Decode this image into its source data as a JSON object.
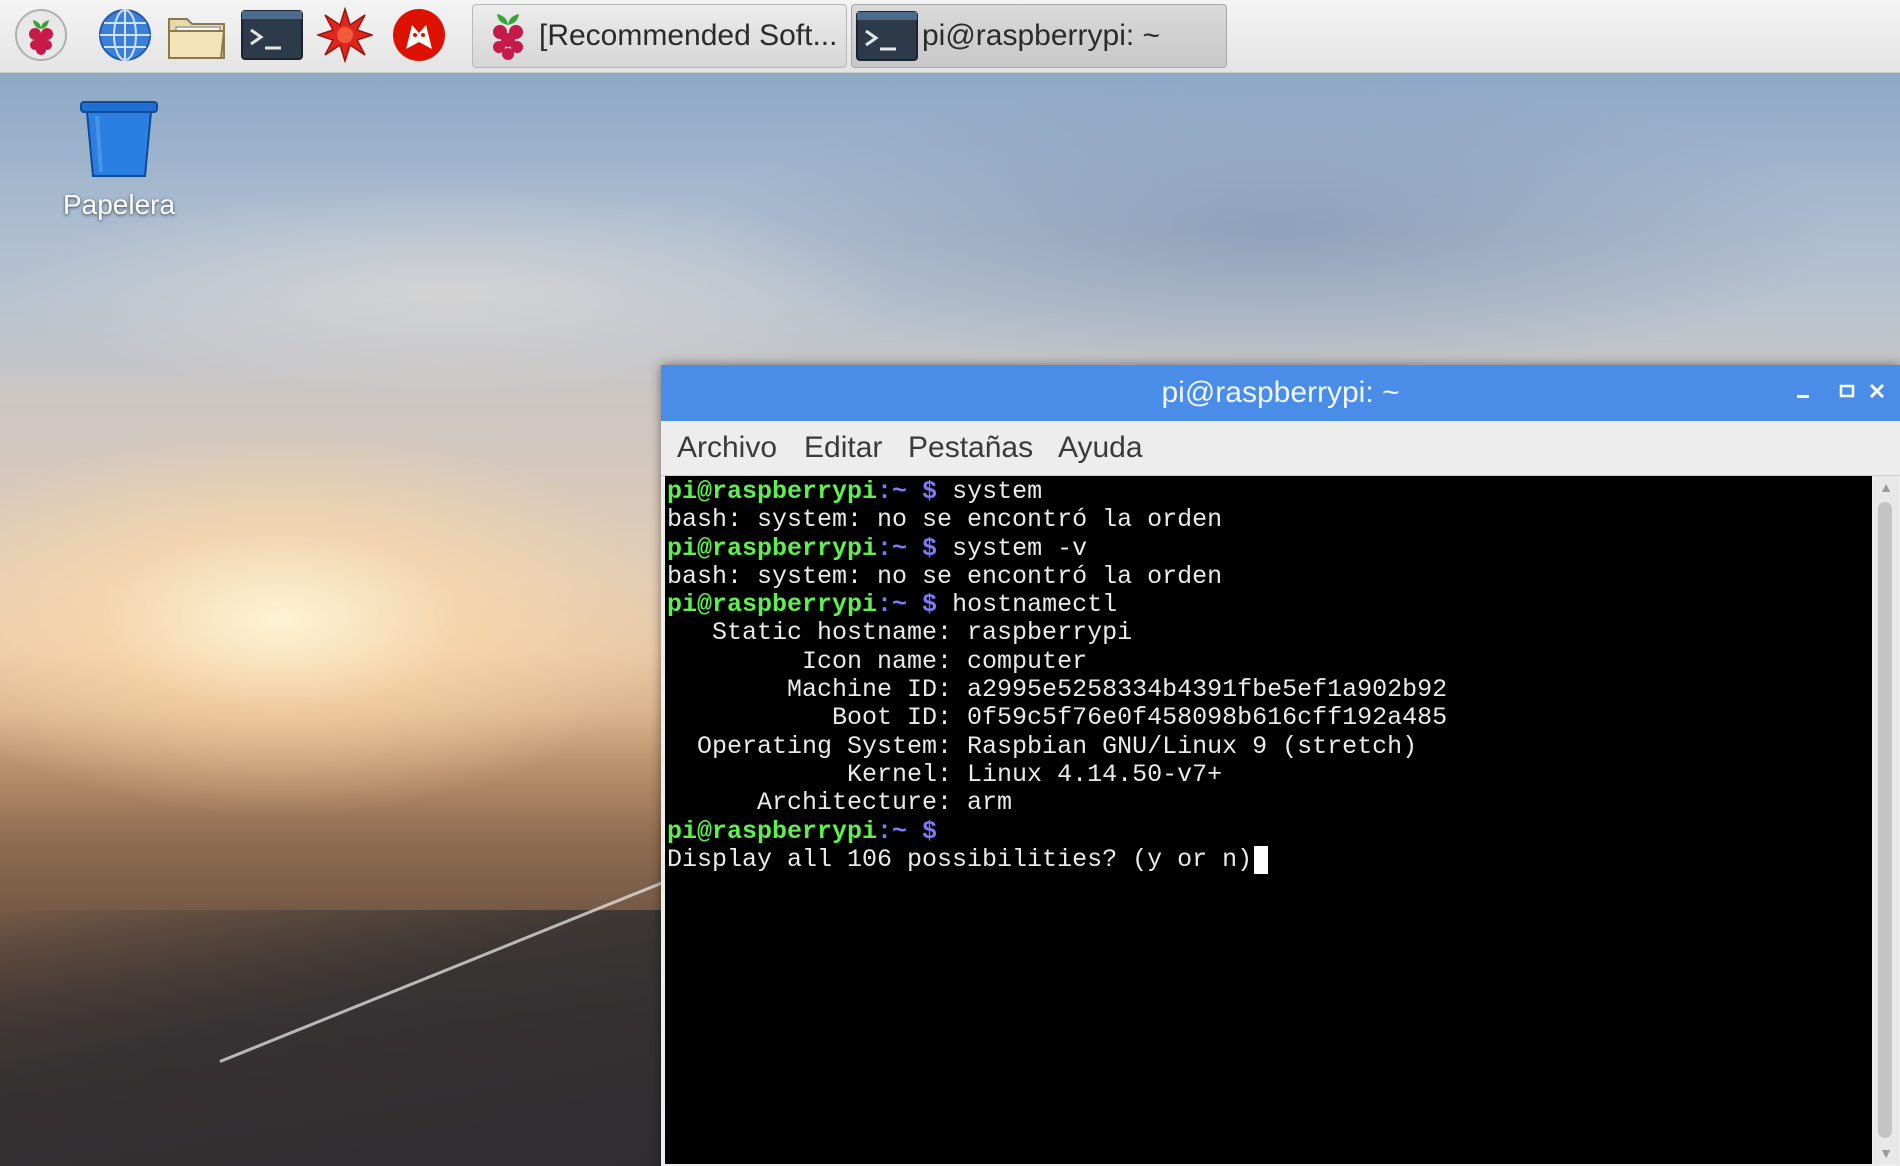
{
  "desktop": {
    "icons": [
      {
        "label": "Papelera",
        "icon": "trash-icon"
      }
    ]
  },
  "taskbar": {
    "launchers": [
      {
        "name": "raspberry-menu",
        "icon": "raspberry-icon"
      },
      {
        "name": "web-browser",
        "icon": "globe-icon"
      },
      {
        "name": "file-manager",
        "icon": "folder-icon"
      },
      {
        "name": "terminal",
        "icon": "terminal-icon"
      },
      {
        "name": "mathematica",
        "icon": "star-burst-icon"
      },
      {
        "name": "wolfram",
        "icon": "wolf-icon"
      }
    ],
    "tasks": [
      {
        "label": "[Recommended Soft...",
        "icon": "raspberry-icon",
        "active": false
      },
      {
        "label": "pi@raspberrypi: ~",
        "icon": "terminal-icon",
        "active": true
      }
    ]
  },
  "window": {
    "title": "pi@raspberrypi: ~",
    "controls": {
      "minimize": "minimize-icon",
      "maximize": "maximize-icon",
      "close": "close-icon"
    },
    "menu": [
      "Archivo",
      "Editar",
      "Pestañas",
      "Ayuda"
    ]
  },
  "terminal": {
    "prompt_user": "pi@raspberrypi",
    "prompt_path": ":~ $",
    "lines": [
      {
        "prompt": true,
        "text": " system"
      },
      {
        "prompt": false,
        "text": "bash: system: no se encontró la orden"
      },
      {
        "prompt": true,
        "text": " system -v"
      },
      {
        "prompt": false,
        "text": "bash: system: no se encontró la orden"
      },
      {
        "prompt": true,
        "text": " hostnamectl"
      },
      {
        "prompt": false,
        "text": "   Static hostname: raspberrypi"
      },
      {
        "prompt": false,
        "text": "         Icon name: computer"
      },
      {
        "prompt": false,
        "text": "        Machine ID: a2995e5258334b4391fbe5ef1a902b92"
      },
      {
        "prompt": false,
        "text": "           Boot ID: 0f59c5f76e0f458098b616cff192a485"
      },
      {
        "prompt": false,
        "text": "  Operating System: Raspbian GNU/Linux 9 (stretch)"
      },
      {
        "prompt": false,
        "text": "            Kernel: Linux 4.14.50-v7+"
      },
      {
        "prompt": false,
        "text": "      Architecture: arm"
      },
      {
        "prompt": true,
        "text": ""
      },
      {
        "prompt": false,
        "text": "Display all 106 possibilities? (y or n)",
        "cursor": true
      }
    ]
  },
  "colors": {
    "title_bar": "#4a8de8",
    "prompt_user": "#5ff050",
    "prompt_path": "#7b7bff",
    "terminal_bg": "#000000"
  }
}
